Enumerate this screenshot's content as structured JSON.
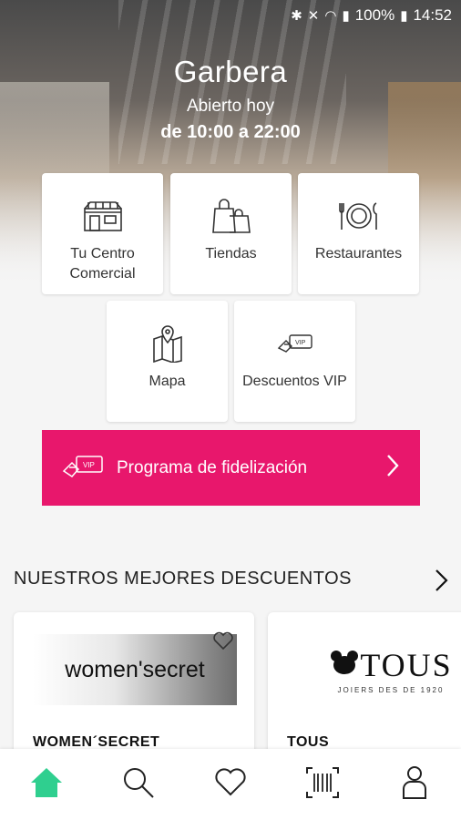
{
  "status_bar": {
    "battery": "100%",
    "time": "14:52"
  },
  "hero": {
    "mall_name": "Garbera",
    "open_label": "Abierto hoy",
    "open_hours": "de 10:00 a 22:00"
  },
  "tiles": [
    {
      "label": "Tu Centro Comercial",
      "icon": "shopping-center-icon"
    },
    {
      "label": "Tiendas",
      "icon": "shopping-bags-icon"
    },
    {
      "label": "Restaurantes",
      "icon": "plate-cutlery-icon"
    },
    {
      "label": "Mapa",
      "icon": "map-pin-icon"
    },
    {
      "label": "Descuentos VIP",
      "icon": "vip-card-icon"
    }
  ],
  "loyalty": {
    "label": "Programa de fidelización",
    "icon": "vip-card-icon"
  },
  "discounts": {
    "title": "NUESTROS MEJORES DESCUENTOS",
    "cards": [
      {
        "logo_text": "women'secret",
        "name": "WOMEN´SECRET"
      },
      {
        "logo_text": "TOUS",
        "logo_tagline": "JOIERS DES DE 1920",
        "name": "TOUS"
      }
    ]
  },
  "nav": [
    "home-icon",
    "search-icon",
    "heart-icon",
    "barcode-scan-icon",
    "profile-icon"
  ],
  "colors": {
    "accent": "#e8176c",
    "home_active": "#2fcf8f"
  }
}
